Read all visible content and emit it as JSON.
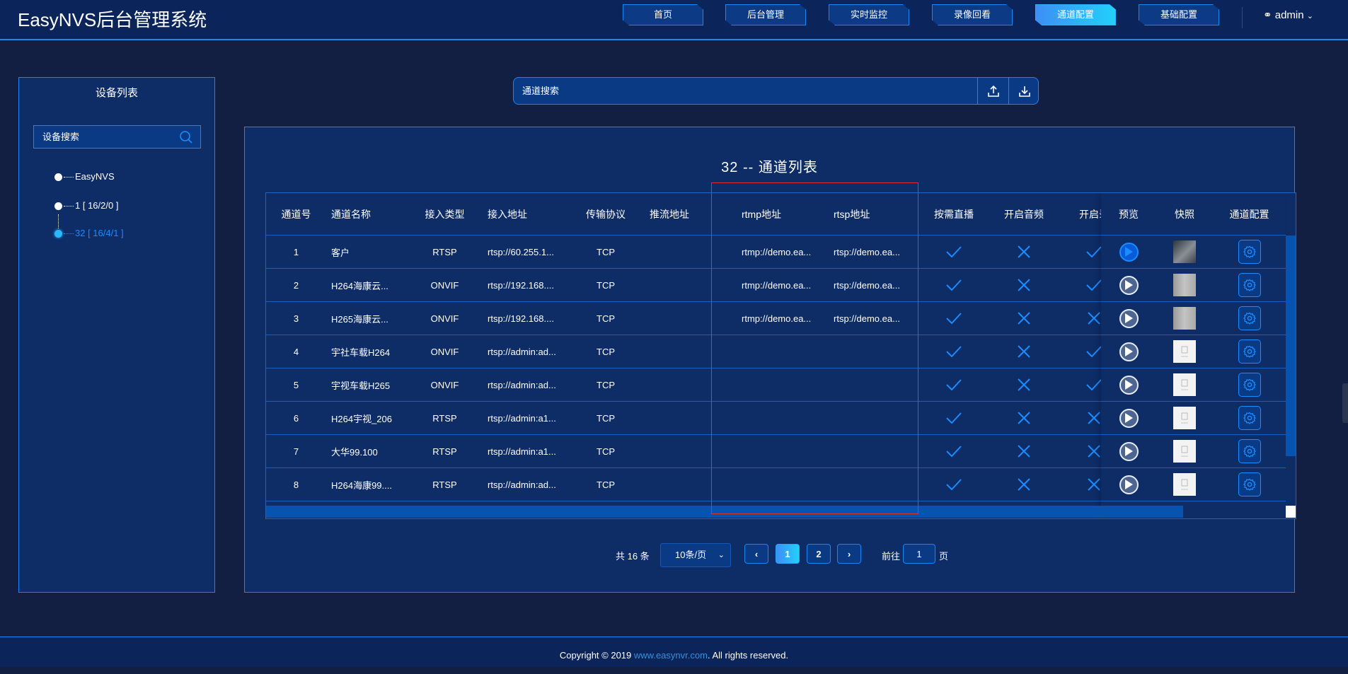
{
  "header": {
    "title": "EasyNVS后台管理系统",
    "nav": [
      "首页",
      "后台管理",
      "实时监控",
      "录像回看",
      "通道配置",
      "基础配置"
    ],
    "active_nav": 4,
    "user": "admin"
  },
  "sidebar": {
    "title": "设备列表",
    "search_placeholder": "设备搜索",
    "tree": [
      "EasyNVS",
      "1 [ 16/2/0 ]",
      "32 [ 16/4/1 ]"
    ],
    "selected": 2
  },
  "channel_search": {
    "placeholder": "通道搜索"
  },
  "main": {
    "title": "32 -- 通道列表"
  },
  "table": {
    "columns": [
      "通道号",
      "通道名称",
      "接入类型",
      "接入地址",
      "传输协议",
      "推流地址",
      "rtmp地址",
      "rtsp地址",
      "按需直播",
      "开启音频",
      "开启录",
      "预览",
      "快照",
      "通道配置"
    ],
    "rows": [
      {
        "id": "1",
        "name": "客户",
        "type": "RTSP",
        "addr": "rtsp://60.255.1...",
        "proto": "TCP",
        "push": "",
        "rtmp": "rtmp://demo.ea...",
        "rtsp": "rtsp://demo.ea...",
        "ondemand": true,
        "audio": false,
        "record": true,
        "playing": true,
        "snapshot": "dark"
      },
      {
        "id": "2",
        "name": "H264海康云...",
        "type": "ONVIF",
        "addr": "rtsp://192.168....",
        "proto": "TCP",
        "push": "",
        "rtmp": "rtmp://demo.ea...",
        "rtsp": "rtsp://demo.ea...",
        "ondemand": true,
        "audio": false,
        "record": true,
        "playing": false,
        "snapshot": "gray"
      },
      {
        "id": "3",
        "name": "H265海康云...",
        "type": "ONVIF",
        "addr": "rtsp://192.168....",
        "proto": "TCP",
        "push": "",
        "rtmp": "rtmp://demo.ea...",
        "rtsp": "rtsp://demo.ea...",
        "ondemand": true,
        "audio": false,
        "record": false,
        "playing": false,
        "snapshot": "gray"
      },
      {
        "id": "4",
        "name": "宇社车载H264",
        "type": "ONVIF",
        "addr": "rtsp://admin:ad...",
        "proto": "TCP",
        "push": "",
        "rtmp": "",
        "rtsp": "",
        "ondemand": true,
        "audio": false,
        "record": true,
        "playing": false,
        "snapshot": "placeholder"
      },
      {
        "id": "5",
        "name": "宇视车载H265",
        "type": "ONVIF",
        "addr": "rtsp://admin:ad...",
        "proto": "TCP",
        "push": "",
        "rtmp": "",
        "rtsp": "",
        "ondemand": true,
        "audio": false,
        "record": true,
        "playing": false,
        "snapshot": "placeholder"
      },
      {
        "id": "6",
        "name": "H264宇视_206",
        "type": "RTSP",
        "addr": "rtsp://admin:a1...",
        "proto": "TCP",
        "push": "",
        "rtmp": "",
        "rtsp": "",
        "ondemand": true,
        "audio": false,
        "record": false,
        "playing": false,
        "snapshot": "placeholder"
      },
      {
        "id": "7",
        "name": "大华99.100",
        "type": "RTSP",
        "addr": "rtsp://admin:a1...",
        "proto": "TCP",
        "push": "",
        "rtmp": "",
        "rtsp": "",
        "ondemand": true,
        "audio": false,
        "record": false,
        "playing": false,
        "snapshot": "placeholder"
      },
      {
        "id": "8",
        "name": "H264海康99....",
        "type": "RTSP",
        "addr": "rtsp://admin:ad...",
        "proto": "TCP",
        "push": "",
        "rtmp": "",
        "rtsp": "",
        "ondemand": true,
        "audio": false,
        "record": false,
        "playing": false,
        "snapshot": "placeholder"
      }
    ]
  },
  "pagination": {
    "total": "共 16 条",
    "page_size": "10条/页",
    "pages": [
      "1",
      "2"
    ],
    "current": "1",
    "goto_label": "前往",
    "goto_value": "1",
    "page_suffix": "页"
  },
  "footer": {
    "prefix": "Copyright © 2019 ",
    "link": "www.easynvr.com",
    "suffix": ". All rights reserved."
  },
  "colors": {
    "accent": "#1a86f0",
    "panel": "#0e2c66",
    "highlight": "#e0302a"
  }
}
